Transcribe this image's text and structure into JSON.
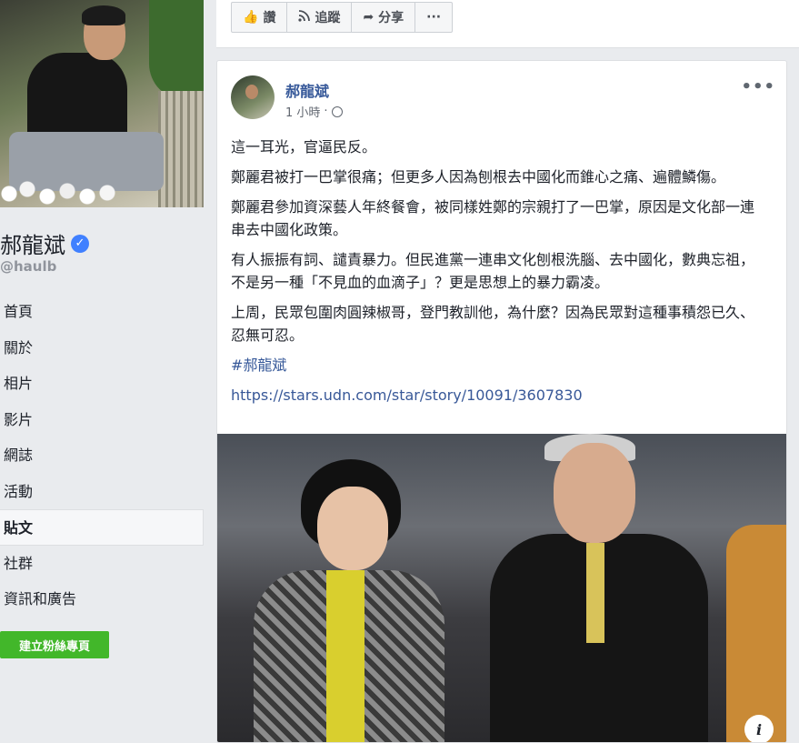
{
  "sidebar": {
    "page_name": "郝龍斌",
    "handle": "@haulb",
    "nav": [
      {
        "label": "首頁"
      },
      {
        "label": "關於"
      },
      {
        "label": "相片"
      },
      {
        "label": "影片"
      },
      {
        "label": "網誌"
      },
      {
        "label": "活動"
      },
      {
        "label": "貼文",
        "active": true
      },
      {
        "label": "社群"
      },
      {
        "label": "資訊和廣告"
      }
    ],
    "create_page_label": "建立粉絲專頁"
  },
  "action_bar": {
    "like_label": "讚",
    "follow_label": "追蹤",
    "share_label": "分享",
    "more_label": "···"
  },
  "post": {
    "author": "郝龍斌",
    "time": "1 小時",
    "separator": "·",
    "more_label": "•••",
    "paragraphs": [
      "這一耳光，官逼民反。",
      "鄭麗君被打一巴掌很痛；但更多人因為刨根去中國化而錐心之痛、遍體鱗傷。",
      "鄭麗君參加資深藝人年終餐會，被同樣姓鄭的宗親打了一巴掌，原因是文化部一連串去中國化政策。",
      "有人振振有詞、譴責暴力。但民進黨一連串文化刨根洗腦、去中國化，數典忘祖，不是另一種「不見血的血滴子」？更是思想上的暴力霸凌。",
      "上周，民眾包圍肉圓辣椒哥，登門教訓他，為什麼？因為民眾對這種事積怨已久、忍無可忍。"
    ],
    "hashtag": "#郝龍斌",
    "link": "https://stars.udn.com/star/story/10091/3607830",
    "info_label": "i"
  },
  "colors": {
    "link_blue": "#365899",
    "create_green": "#42b72a",
    "verified_blue": "#4080ff",
    "background": "#e9ebee"
  }
}
